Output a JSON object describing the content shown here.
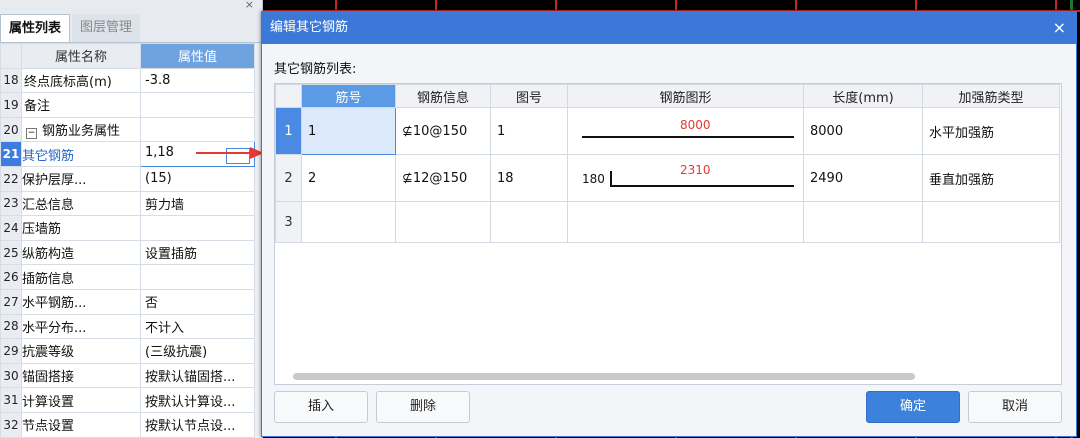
{
  "panel": {
    "tabs": [
      {
        "label": "属性列表"
      },
      {
        "label": "图层管理"
      }
    ],
    "header": {
      "name": "属性名称",
      "value": "属性值"
    },
    "rows": [
      {
        "num": "18",
        "name": "终点底标高(m)",
        "value": "-3.8"
      },
      {
        "num": "19",
        "name": "备注",
        "value": ""
      },
      {
        "num": "20",
        "name": "钢筋业务属性",
        "value": ""
      },
      {
        "num": "21",
        "name": "其它钢筋",
        "value": "1,18"
      },
      {
        "num": "22",
        "name": "保护层厚...",
        "value": "(15)"
      },
      {
        "num": "23",
        "name": "汇总信息",
        "value": "剪力墙"
      },
      {
        "num": "24",
        "name": "压墙筋",
        "value": ""
      },
      {
        "num": "25",
        "name": "纵筋构造",
        "value": "设置插筋"
      },
      {
        "num": "26",
        "name": "插筋信息",
        "value": ""
      },
      {
        "num": "27",
        "name": "水平钢筋...",
        "value": "否"
      },
      {
        "num": "28",
        "name": "水平分布...",
        "value": "不计入"
      },
      {
        "num": "29",
        "name": "抗震等级",
        "value": "(三级抗震)"
      },
      {
        "num": "30",
        "name": "锚固搭接",
        "value": "按默认锚固搭..."
      },
      {
        "num": "31",
        "name": "计算设置",
        "value": "按默认计算设..."
      },
      {
        "num": "32",
        "name": "节点设置",
        "value": "按默认节点设..."
      }
    ]
  },
  "dialog": {
    "title": "编辑其它钢筋",
    "list_label": "其它钢筋列表:",
    "columns": [
      "筋号",
      "钢筋信息",
      "图号",
      "钢筋图形",
      "长度(mm)",
      "加强筋类型"
    ],
    "rows": [
      {
        "rn": "1",
        "no": "1",
        "info": "⊈10@150",
        "fig": "1",
        "shape_value": "8000",
        "shape_left": "",
        "length": "8000",
        "type": "水平加强筋"
      },
      {
        "rn": "2",
        "no": "2",
        "info": "⊈12@150",
        "fig": "18",
        "shape_value": "2310",
        "shape_left": "180",
        "length": "2490",
        "type": "垂直加强筋"
      },
      {
        "rn": "3",
        "no": "",
        "info": "",
        "fig": "",
        "shape_value": "",
        "shape_left": "",
        "length": "",
        "type": ""
      }
    ],
    "buttons": {
      "insert": "插入",
      "delete": "删除",
      "ok": "确定",
      "cancel": "取消"
    }
  },
  "colors": {
    "title_bar": "#3c78d8",
    "header_highlight": "#5b9be6",
    "arrow": "#e53935"
  }
}
